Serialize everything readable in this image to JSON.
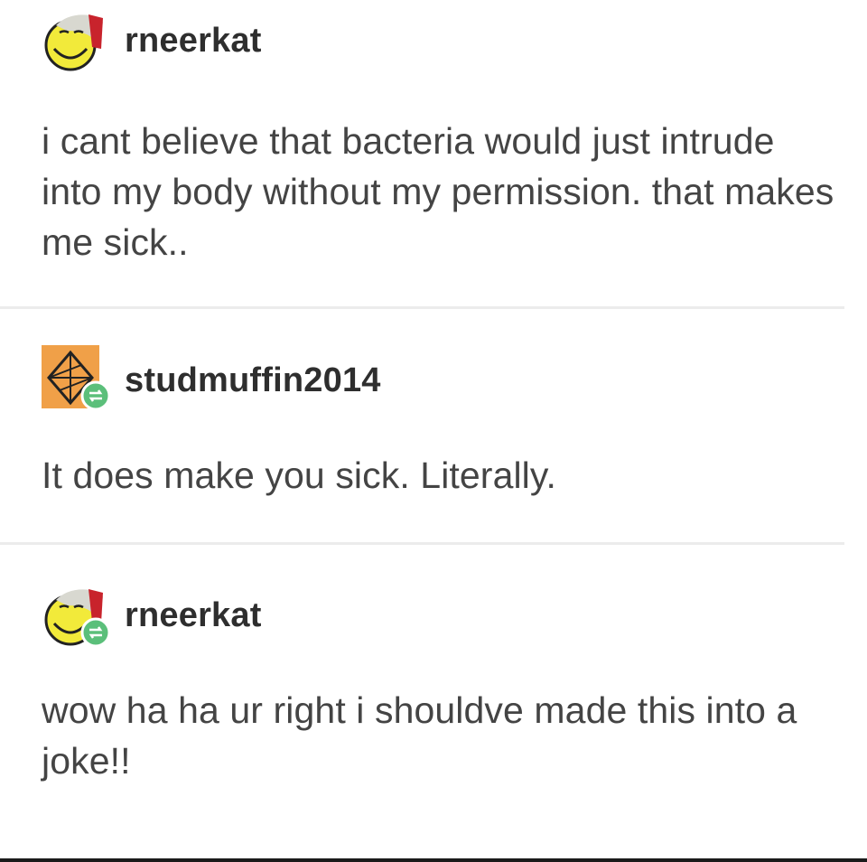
{
  "posts": [
    {
      "username": "rneerkat",
      "avatar_icon": "smiley-santa-hat-avatar",
      "reblog_badge": false,
      "text": "i cant believe that bacteria would just intrude into my body without my permission. that makes me sick.."
    },
    {
      "username": "studmuffin2014",
      "avatar_icon": "geometric-shape-avatar",
      "reblog_badge": true,
      "text": "It does make you sick. Literally."
    },
    {
      "username": "rneerkat",
      "avatar_icon": "smiley-santa-hat-avatar",
      "reblog_badge": true,
      "text": "wow ha ha ur right i shouldve made this into a joke!!"
    }
  ],
  "colors": {
    "text": "#444444",
    "username": "#2e2e2e",
    "divider": "#ececec",
    "reblog_badge": "#5bbf7a",
    "avatar_orange": "#f0a048",
    "avatar_yellow": "#f2ea3a"
  }
}
